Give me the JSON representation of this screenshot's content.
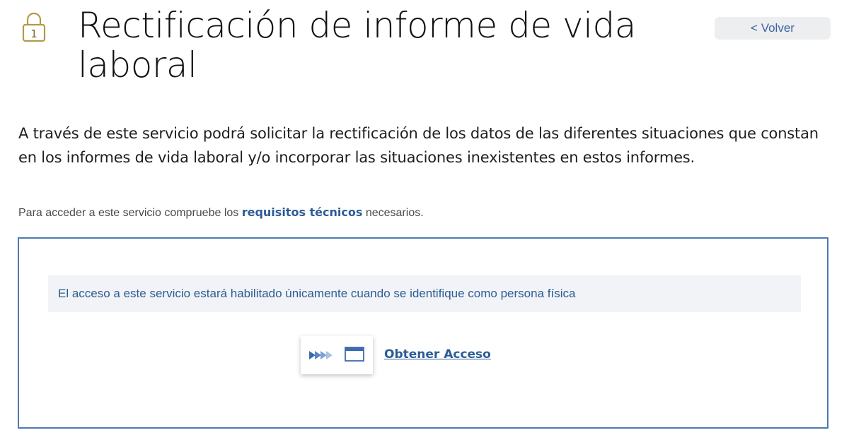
{
  "header": {
    "title": "Rectificación de informe de vida laboral",
    "lock_badge_number": "1",
    "back_button_label": "< Volver"
  },
  "intro": {
    "text": "A través de este servicio podrá solicitar la rectificación de los datos de las diferentes situaciones que constan en los informes de vida laboral y/o incorporar las situaciones inexistentes en estos informes."
  },
  "requirements": {
    "prefix": "Para acceder a este servicio compruebe los ",
    "link_label": "requisitos técnicos",
    "suffix": " necesarios."
  },
  "access_panel": {
    "notice": "El acceso a este servicio estará habilitado únicamente cuando se identifique como persona física",
    "access_link_label": "Obtener Acceso"
  },
  "colors": {
    "accent_blue": "#2c5c96",
    "panel_border": "#4d7ab0",
    "lock_gold": "#b39a4a",
    "notice_bg": "#f1f3f6",
    "button_bg": "#eceef0"
  },
  "icons": {
    "lock": "padlock-icon",
    "access_arrows": "forward-arrows-icon",
    "access_window": "window-icon"
  }
}
